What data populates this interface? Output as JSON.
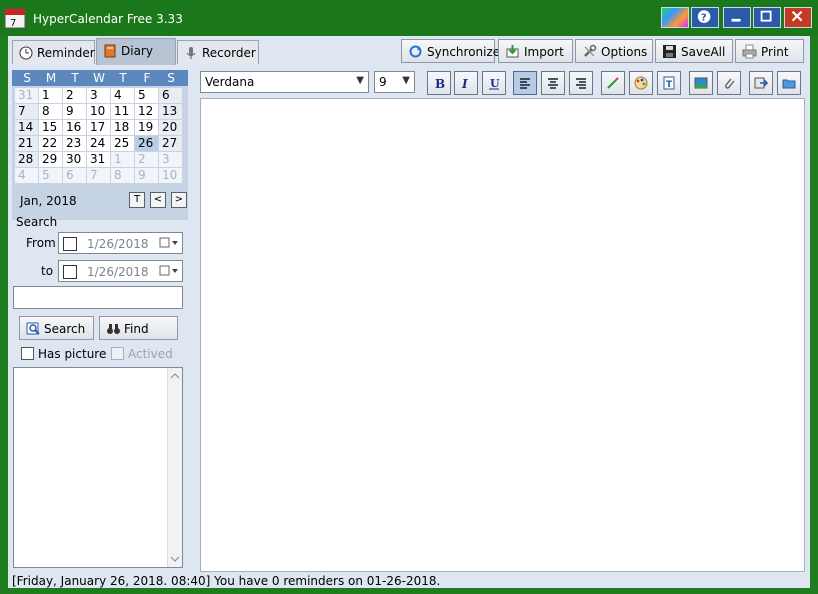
{
  "window": {
    "title": "HyperCalendar Free 3.33"
  },
  "tabs": [
    {
      "label": "Reminder",
      "icon": "clock-icon"
    },
    {
      "label": "Diary",
      "icon": "diary-icon"
    },
    {
      "label": "Recorder",
      "icon": "microphone-icon"
    }
  ],
  "toolbar": [
    {
      "label": "Synchronize",
      "icon": "sync-icon"
    },
    {
      "label": "Import",
      "icon": "import-icon"
    },
    {
      "label": "Options",
      "icon": "wrench-icon"
    },
    {
      "label": "SaveAll",
      "icon": "save-icon"
    },
    {
      "label": "Print",
      "icon": "printer-icon"
    }
  ],
  "calendar": {
    "weekdays": [
      "S",
      "M",
      "T",
      "W",
      "T",
      "F",
      "S"
    ],
    "weeks": [
      [
        "31",
        "1",
        "2",
        "3",
        "4",
        "5",
        "6"
      ],
      [
        "7",
        "8",
        "9",
        "10",
        "11",
        "12",
        "13"
      ],
      [
        "14",
        "15",
        "16",
        "17",
        "18",
        "19",
        "20"
      ],
      [
        "21",
        "22",
        "23",
        "24",
        "25",
        "26",
        "27"
      ],
      [
        "28",
        "29",
        "30",
        "31",
        "1",
        "2",
        "3"
      ],
      [
        "4",
        "5",
        "6",
        "7",
        "8",
        "9",
        "10"
      ]
    ],
    "month_label": "Jan, 2018",
    "today_button": "T",
    "prev_button": "<",
    "next_button": ">"
  },
  "search": {
    "group_label": "Search",
    "from_label": "From",
    "to_label": "to",
    "from_date": "1/26/2018",
    "to_date": "1/26/2018",
    "keyword": "",
    "search_button": "Search",
    "find_button": "Find",
    "has_picture_label": "Has picture",
    "actived_label": "Actived"
  },
  "format": {
    "font": "Verdana",
    "size": "9"
  },
  "status": {
    "text": "[Friday, January 26, 2018. 08:40] You have 0 reminders on 01-26-2018."
  },
  "colors": {
    "titlebar": "#1a781a",
    "client": "#dde6f1",
    "calendar_header": "#5b87bd"
  }
}
